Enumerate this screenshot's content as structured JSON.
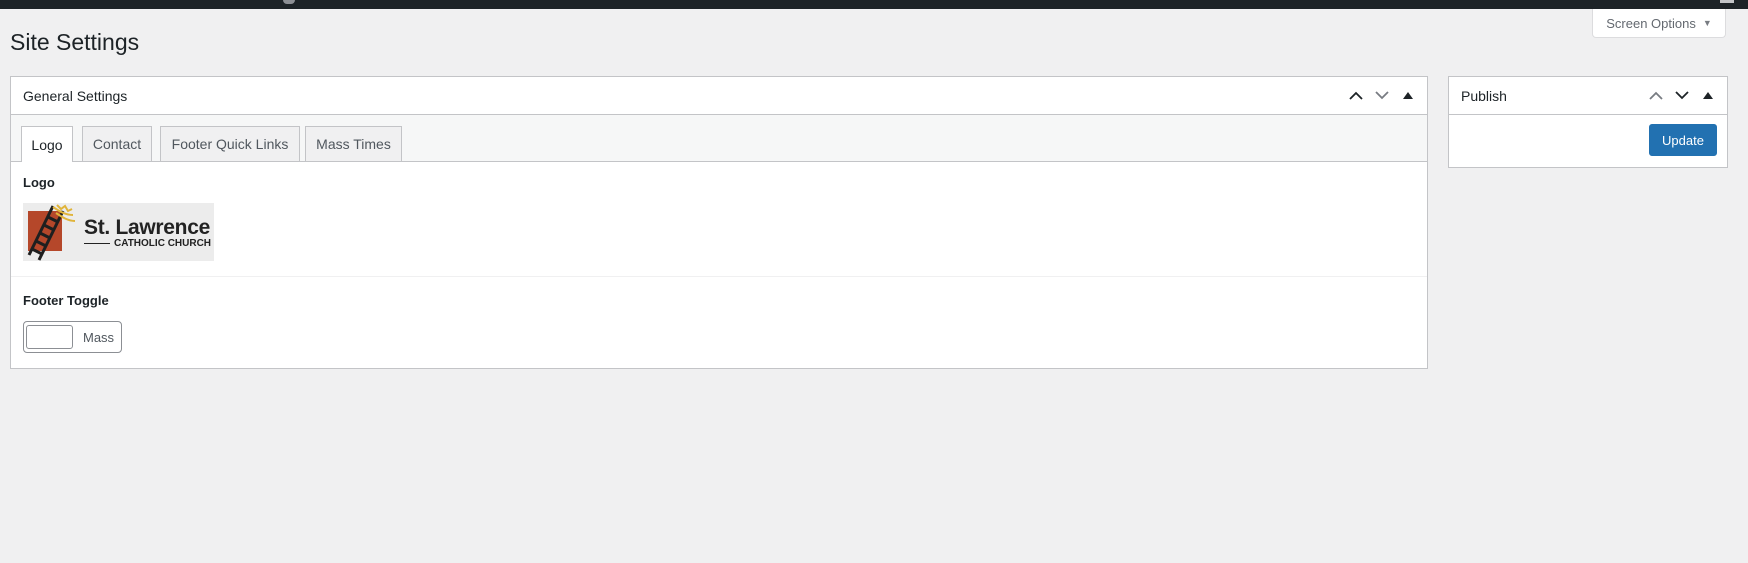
{
  "screen_options": {
    "label": "Screen Options",
    "caret_icon": "caret-down-icon"
  },
  "page": {
    "title": "Site Settings"
  },
  "general_box": {
    "title": "General Settings",
    "tabs": [
      {
        "label": "Logo",
        "active": true
      },
      {
        "label": "Contact",
        "active": false
      },
      {
        "label": "Footer Quick Links",
        "active": false
      },
      {
        "label": "Mass Times",
        "active": false
      }
    ],
    "logo_field": {
      "label": "Logo",
      "image": {
        "name": "St. Lawrence",
        "tagline": "CATHOLIC CHURCH"
      }
    },
    "footer_toggle": {
      "label": "Footer Toggle",
      "option_label": "Mass",
      "checked": false
    }
  },
  "publish_box": {
    "title": "Publish",
    "update_label": "Update"
  },
  "colors": {
    "accent": "#2271b1",
    "admin_bar": "#1d2327",
    "background": "#f0f0f1"
  }
}
